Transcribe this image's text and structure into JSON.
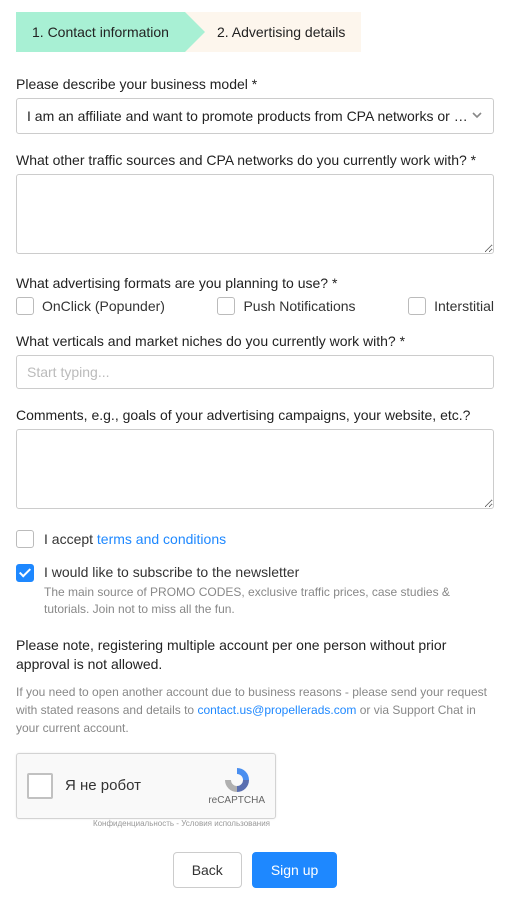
{
  "steps": {
    "s1": "1. Contact information",
    "s2": "2. Advertising details"
  },
  "q1": {
    "label": "Please describe your business model",
    "value": "I am an affiliate and want to promote products from CPA networks or direct a…"
  },
  "q2": {
    "label": "What other traffic sources and CPA networks do you currently work with?"
  },
  "q3": {
    "label": "What advertising formats are you planning to use?",
    "opt1": "OnClick (Popunder)",
    "opt2": "Push Notifications",
    "opt3": "Interstitial"
  },
  "q4": {
    "label": "What verticals and market niches do you currently work with?",
    "placeholder": "Start typing..."
  },
  "q5": {
    "label": "Comments, e.g., goals of your advertising campaigns, your website, etc.?"
  },
  "accept": {
    "prefix": "I accept ",
    "link": "terms and conditions"
  },
  "subscribe": {
    "title": "I would like to subscribe to the newsletter",
    "desc": "The main source of PROMO CODES, exclusive traffic prices, case studies & tutorials. Join not to miss all the fun."
  },
  "note": {
    "strong": "Please note, registering multiple account per one person without prior approval is not allowed.",
    "muted_before": "If you need to open another account due to business reasons - please send your request with stated reasons and details to ",
    "email": "contact.us@propellerads.com",
    "muted_after": " or via Support Chat in your current account."
  },
  "recaptcha": {
    "label": "Я не робот",
    "name": "reCAPTCHA",
    "privacy": "Конфиденциальность - Условия использования"
  },
  "buttons": {
    "back": "Back",
    "signup": "Sign up"
  }
}
